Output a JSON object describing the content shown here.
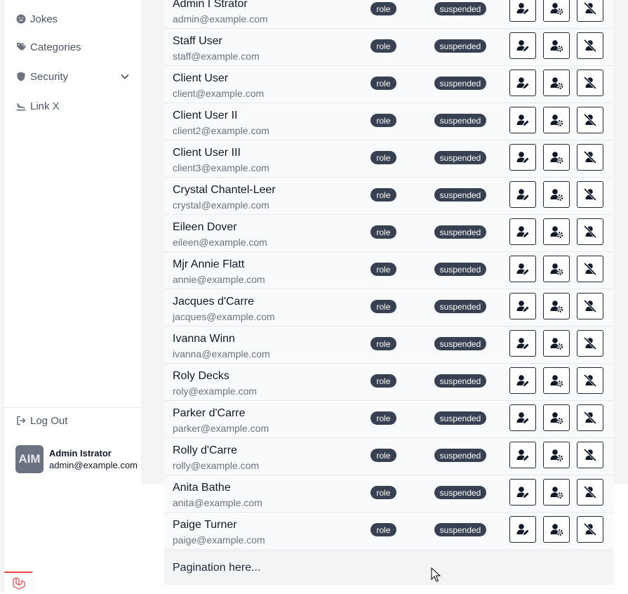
{
  "sidebar": {
    "items": [
      {
        "label": "Jokes",
        "icon": "smile-icon"
      },
      {
        "label": "Categories",
        "icon": "tags-icon"
      },
      {
        "label": "Security",
        "icon": "shield-icon"
      },
      {
        "label": "Link X",
        "icon": "plane-landing-icon"
      }
    ],
    "logout_label": "Log Out",
    "user": {
      "initials": "AIM",
      "name": "Admin Istrator",
      "email": "admin@example.com"
    }
  },
  "users_table": {
    "rows": [
      {
        "name": "Admin I Strator",
        "email": "admin@example.com",
        "role": "role",
        "status": "suspended"
      },
      {
        "name": "Staff User",
        "email": "staff@example.com",
        "role": "role",
        "status": "suspended"
      },
      {
        "name": "Client User",
        "email": "client@example.com",
        "role": "role",
        "status": "suspended"
      },
      {
        "name": "Client User II",
        "email": "client2@example.com",
        "role": "role",
        "status": "suspended"
      },
      {
        "name": "Client User III",
        "email": "client3@example.com",
        "role": "role",
        "status": "suspended"
      },
      {
        "name": "Crystal Chantel-Leer",
        "email": "crystal@example.com",
        "role": "role",
        "status": "suspended"
      },
      {
        "name": "Eileen Dover",
        "email": "eileen@example.com",
        "role": "role",
        "status": "suspended"
      },
      {
        "name": "Mjr Annie Flatt",
        "email": "annie@example.com",
        "role": "role",
        "status": "suspended"
      },
      {
        "name": "Jacques d'Carre",
        "email": "jacques@example.com",
        "role": "role",
        "status": "suspended"
      },
      {
        "name": "Ivanna Winn",
        "email": "ivanna@example.com",
        "role": "role",
        "status": "suspended"
      },
      {
        "name": "Roly Decks",
        "email": "roly@example.com",
        "role": "role",
        "status": "suspended"
      },
      {
        "name": "Parker d'Carre",
        "email": "parker@example.com",
        "role": "role",
        "status": "suspended"
      },
      {
        "name": "Rolly d'Carre",
        "email": "rolly@example.com",
        "role": "role",
        "status": "suspended"
      },
      {
        "name": "Anita Bathe",
        "email": "anita@example.com",
        "role": "role",
        "status": "suspended"
      },
      {
        "name": "Paige Turner",
        "email": "paige@example.com",
        "role": "role",
        "status": "suspended"
      }
    ],
    "actions": [
      "user-edit-icon",
      "user-gear-icon",
      "user-slash-icon"
    ]
  },
  "pagination": {
    "text": "Pagination here..."
  },
  "colors": {
    "pill": "#374151",
    "accent_red": "#ef4444",
    "avatar": "#6b7280"
  }
}
